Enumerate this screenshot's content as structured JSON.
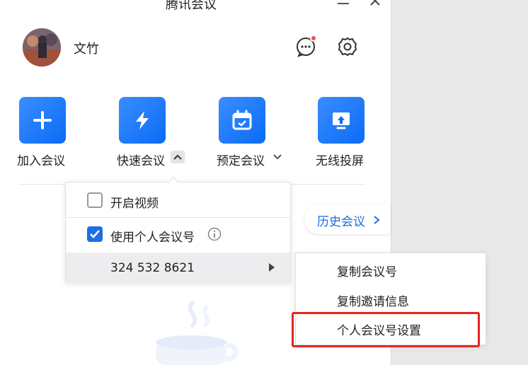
{
  "window": {
    "title": "腾讯会议"
  },
  "user": {
    "name": "文竹"
  },
  "actions": [
    {
      "label": "加入会议",
      "icon": "plus-icon"
    },
    {
      "label": "快速会议",
      "icon": "lightning-icon"
    },
    {
      "label": "预定会议",
      "icon": "calendar-icon"
    },
    {
      "label": "无线投屏",
      "icon": "screen-cast-icon"
    }
  ],
  "history": {
    "label": "历史会议"
  },
  "dropdown": {
    "video_label": "开启视频",
    "video_checked": false,
    "pmi_label": "使用个人会议号",
    "pmi_checked": true,
    "meeting_id": "324 532 8621"
  },
  "submenu": {
    "items": [
      "复制会议号",
      "复制邀请信息",
      "个人会议号设置"
    ]
  },
  "colors": {
    "accent": "#1c6fe5",
    "highlight": "#e8251d",
    "badge": "#f24d4d"
  }
}
